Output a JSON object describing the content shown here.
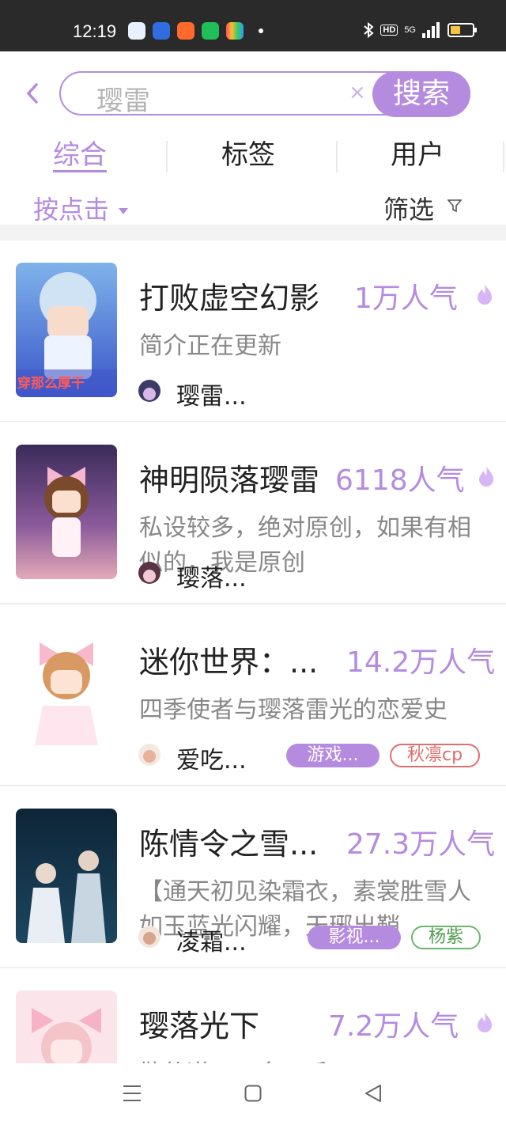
{
  "status": {
    "time": "12:19",
    "hd": "HD",
    "net": "5G"
  },
  "search": {
    "query": "璎雷",
    "clear": "×",
    "button": "搜索"
  },
  "tabs": [
    {
      "label": "综合",
      "active": true
    },
    {
      "label": "标签",
      "active": false
    },
    {
      "label": "用户",
      "active": false
    }
  ],
  "sort": {
    "label": "按点击"
  },
  "filter": {
    "label": "筛选"
  },
  "items": [
    {
      "title": "打败虚空幻影",
      "popularity": "1万人气",
      "desc": "简介正在更新",
      "author": "璎雷...",
      "cover_text": "穿那么厚干",
      "tags": []
    },
    {
      "title": "神明陨落璎雷",
      "popularity": "6118人气",
      "desc": "私设较多，绝对原创，如果有相似的，我是原创",
      "author": "璎落...",
      "tags": []
    },
    {
      "title": "迷你世界：...",
      "popularity": "14.2万人气",
      "desc": "四季使者与璎落雷光的恋爱史",
      "author": "爱吃...",
      "tags": [
        "游戏...",
        "秋凛cp"
      ]
    },
    {
      "title": "陈情令之雪...",
      "popularity": "27.3万人气",
      "desc": "【通天初见染霜衣，素裳胜雪人如玉蓝光闪耀，天琊出鞘",
      "author": "凌霜...",
      "tags": [
        "影视...",
        "杨紫"
      ]
    },
    {
      "title": "璎落光下",
      "popularity": "7.2万人气",
      "desc": "散仙道，一多三千",
      "author": "",
      "tags": []
    }
  ],
  "colors": {
    "accent": "#b58be0",
    "text": "#222222",
    "muted": "#888888"
  }
}
